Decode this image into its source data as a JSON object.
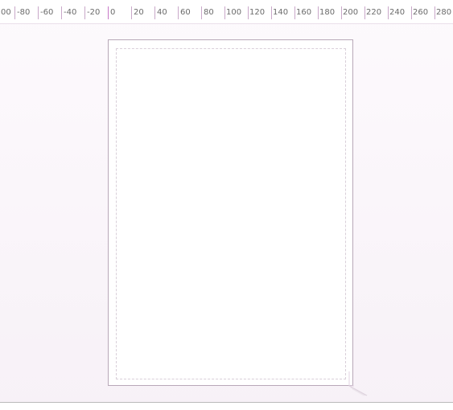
{
  "ruler": {
    "labels": [
      "00",
      "-80",
      "-60",
      "-40",
      "-20",
      "0",
      "20",
      "40",
      "60",
      "80",
      "100",
      "120",
      "140",
      "160",
      "180",
      "200",
      "220",
      "240",
      "260",
      "280"
    ]
  },
  "icons": {
    "resize_handle": "page-resize-handle-icon"
  }
}
